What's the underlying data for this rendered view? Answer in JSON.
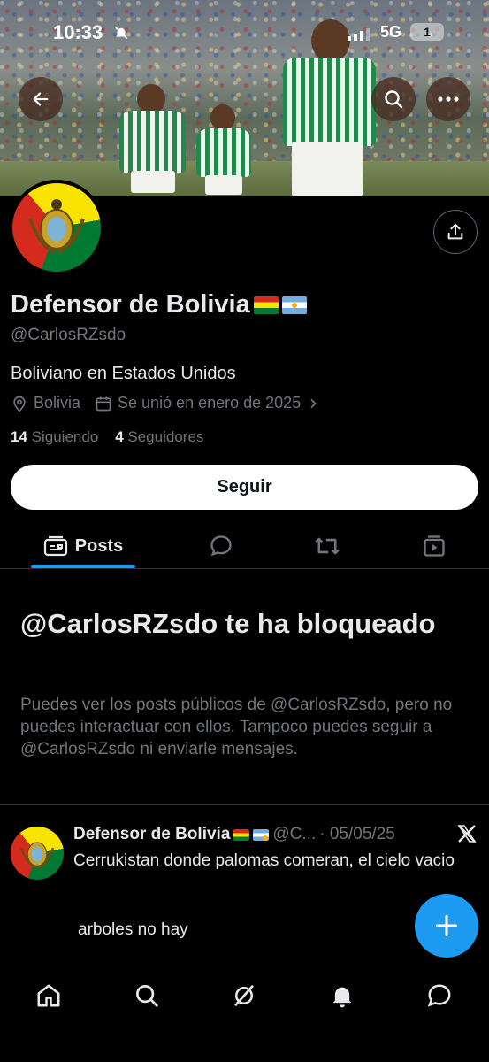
{
  "status_bar": {
    "time": "10:33",
    "network": "5G",
    "battery": "1"
  },
  "profile": {
    "name": "Defensor de Bolivia",
    "handle": "@CarlosRZsdo",
    "bio": "Boliviano en Estados Unidos",
    "location": "Bolivia",
    "joined": "Se unió en enero de 2025",
    "following_count": "14",
    "following_label": "Siguiendo",
    "followers_count": "4",
    "followers_label": "Seguidores",
    "follow_button": "Seguir"
  },
  "tabs": {
    "posts_label": "Posts"
  },
  "blocked": {
    "title": "@CarlosRZsdo te ha bloqueado",
    "text": "Puedes ver los posts públicos de @CarlosRZsdo, pero no puedes interactuar con ellos. Tampoco puedes seguir a @CarlosRZsdo ni enviarle mensajes."
  },
  "post": {
    "author": "Defensor de Bolivia",
    "handle_short": "@C...",
    "date": "· 05/05/25",
    "text": "Cerrukistan donde palomas comeran, el cielo vacio",
    "text2": "arboles no hay"
  },
  "icons": {
    "back": "arrow-left-icon",
    "search": "search-icon",
    "more": "more-icon",
    "share": "share-icon",
    "location": "location-pin-icon",
    "calendar": "calendar-icon",
    "x_logo": "x-logo-icon",
    "compose": "plus-icon",
    "home": "home-icon",
    "explore": "search-icon",
    "grok": "grok-icon",
    "notifications": "bell-icon",
    "messages": "chat-bubble-icon"
  },
  "colors": {
    "accent": "#1d9bf0",
    "background": "#000000",
    "text": "#e7e9ea",
    "muted": "#71767b"
  }
}
